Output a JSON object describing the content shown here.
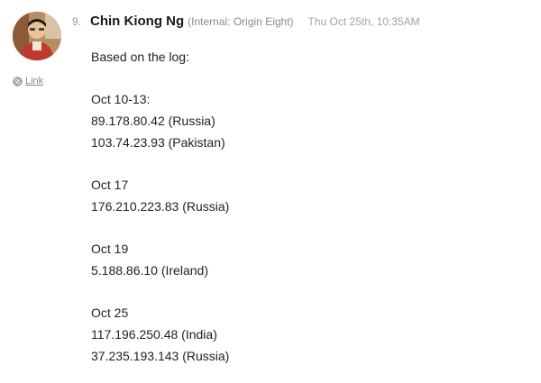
{
  "comment": {
    "number": "9.",
    "author": "Chin Kiong Ng",
    "org": "(Internal: Origin Eight)",
    "timestamp": "Thu Oct 25th, 10:35AM",
    "link_label": "Link",
    "avatar_icon": "user-avatar-photo",
    "link_icon": "link-icon"
  },
  "body": {
    "intro": "Based on the log:",
    "groups": [
      {
        "date": "Oct 10-13:",
        "entries": [
          "89.178.80.42 (Russia)",
          "103.74.23.93 (Pakistan)"
        ]
      },
      {
        "date": "Oct 17",
        "entries": [
          "176.210.223.83 (Russia)"
        ]
      },
      {
        "date": "Oct 19",
        "entries": [
          "5.188.86.10 (Ireland)"
        ]
      },
      {
        "date": "Oct 25",
        "entries": [
          "117.196.250.48 (India)",
          "37.235.193.143 (Russia)"
        ]
      }
    ]
  }
}
